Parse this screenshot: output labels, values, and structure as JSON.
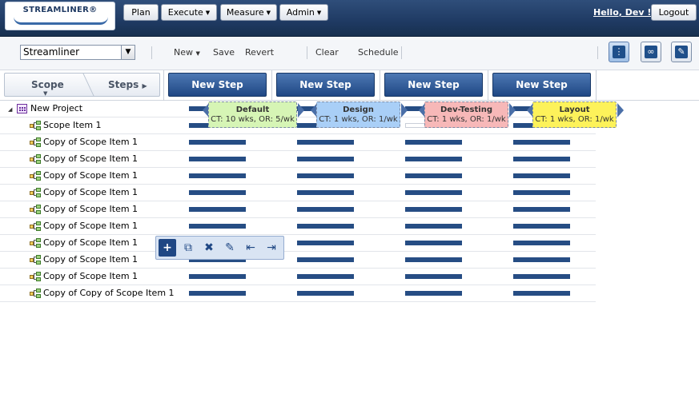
{
  "header": {
    "logo_text": "STREAMLINER®",
    "nav": [
      {
        "label": "Plan"
      },
      {
        "label": "Execute"
      },
      {
        "label": "Measure"
      },
      {
        "label": "Admin"
      }
    ],
    "greeting": "Hello, Dev !",
    "logout_label": "Logout"
  },
  "toolbar": {
    "selector_value": "Streamliner",
    "new_label": "New",
    "save_label": "Save",
    "revert_label": "Revert",
    "clear_label": "Clear",
    "schedule_label": "Schedule"
  },
  "tabs": {
    "scope_label": "Scope",
    "steps_label": "Steps"
  },
  "new_step_label": "New Step",
  "steps": [
    {
      "name": "Default",
      "meta": "CT: 10 wks, OR: 5/wk",
      "color": "#d6f5b5"
    },
    {
      "name": "Design",
      "meta": "CT: 1 wks, OR: 1/wk",
      "color": "#a9cff7"
    },
    {
      "name": "Dev-Testing",
      "meta": "CT: 1 wks, OR: 1/wk",
      "color": "#f7b8b8"
    },
    {
      "name": "Layout",
      "meta": "CT: 1 wks, OR: 1/wk",
      "color": "#fdf25a"
    }
  ],
  "tree": {
    "project": "New Project",
    "items": [
      "Scope Item 1",
      "Copy of Scope Item 1",
      "Copy of Scope Item 1",
      "Copy of Scope Item 1",
      "Copy of Scope Item 1",
      "Copy of Scope Item 1",
      "Copy of Scope Item 1",
      "Copy of Scope Item 1",
      "Copy of Scope Item 1",
      "Copy of Scope Item 1",
      "Copy of Copy of Scope Item 1"
    ]
  },
  "palette_icons": [
    "add-child-icon",
    "copy-icon",
    "delete-icon",
    "edit-icon",
    "outdent-icon",
    "indent-icon"
  ],
  "accent_color": "#1f4784"
}
